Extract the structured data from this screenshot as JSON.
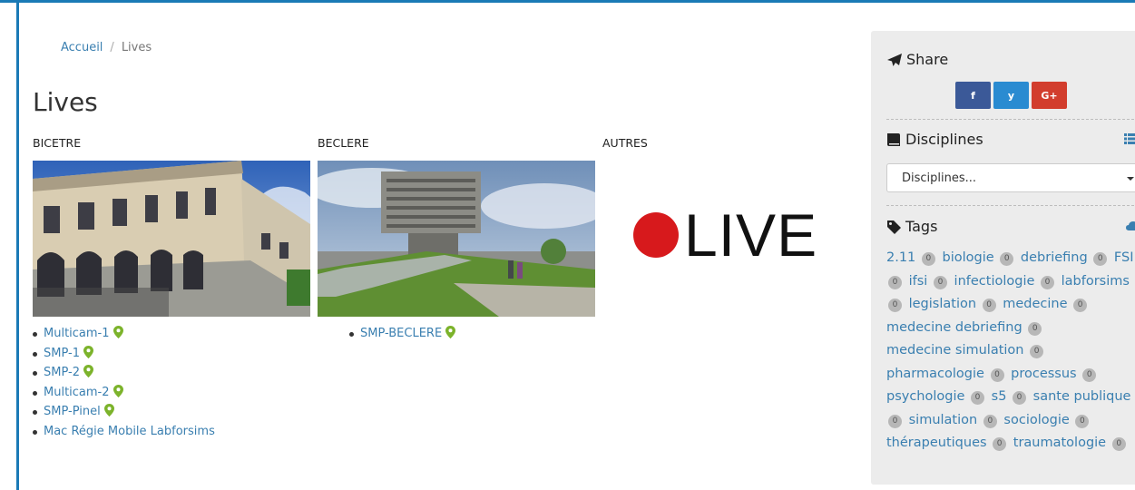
{
  "breadcrumb": {
    "home": "Accueil",
    "separator": "/",
    "current": "Lives"
  },
  "page_title": "Lives",
  "columns": [
    {
      "heading": "BICETRE",
      "items": [
        {
          "label": "Multicam-1",
          "pin": true
        },
        {
          "label": "SMP-1",
          "pin": true
        },
        {
          "label": "SMP-2",
          "pin": true
        },
        {
          "label": "Multicam-2",
          "pin": true
        },
        {
          "label": "SMP-Pinel",
          "pin": true
        },
        {
          "label": "Mac Régie Mobile Labforsims",
          "pin": false
        }
      ]
    },
    {
      "heading": "BECLERE",
      "items": [
        {
          "label": "SMP-BECLERE",
          "pin": true
        }
      ]
    },
    {
      "heading": "AUTRES",
      "live_text": "LIVE"
    }
  ],
  "sidebar": {
    "share": {
      "title": "Share",
      "buttons": [
        "f",
        "y",
        "G+"
      ]
    },
    "disciplines": {
      "title": "Disciplines",
      "select_value": "Disciplines..."
    },
    "tags": {
      "title": "Tags",
      "items": [
        {
          "label": "2.11",
          "count": "0"
        },
        {
          "label": "biologie",
          "count": "0"
        },
        {
          "label": "debriefing",
          "count": "0"
        },
        {
          "label": "FSI",
          "count": "0"
        },
        {
          "label": "ifsi",
          "count": "0"
        },
        {
          "label": "infectiologie",
          "count": "0"
        },
        {
          "label": "labforsims",
          "count": "0"
        },
        {
          "label": "legislation",
          "count": "0"
        },
        {
          "label": "medecine",
          "count": "0"
        },
        {
          "label": "medecine debriefing",
          "count": "0"
        },
        {
          "label": "medecine simulation",
          "count": "0"
        },
        {
          "label": "pharmacologie",
          "count": "0"
        },
        {
          "label": "processus",
          "count": "0"
        },
        {
          "label": "psychologie",
          "count": "0"
        },
        {
          "label": "s5",
          "count": "0"
        },
        {
          "label": "sante publique",
          "count": "0"
        },
        {
          "label": "simulation",
          "count": "0"
        },
        {
          "label": "sociologie",
          "count": "0"
        },
        {
          "label": "thérapeutiques",
          "count": "0"
        },
        {
          "label": "traumatologie",
          "count": "0"
        }
      ]
    }
  },
  "colors": {
    "accent": "#1a7ab6",
    "link": "#3a7fb0",
    "pin": "#7cb32b",
    "live_dot": "#d7191c",
    "facebook": "#3b5998",
    "twitter": "#2a8bd1",
    "google_plus": "#d23d2d"
  },
  "icons": [
    "paper-plane-icon",
    "book-icon",
    "list-icon",
    "tag-icon",
    "cloud-icon",
    "map-pin-icon",
    "chevron-down-icon"
  ]
}
